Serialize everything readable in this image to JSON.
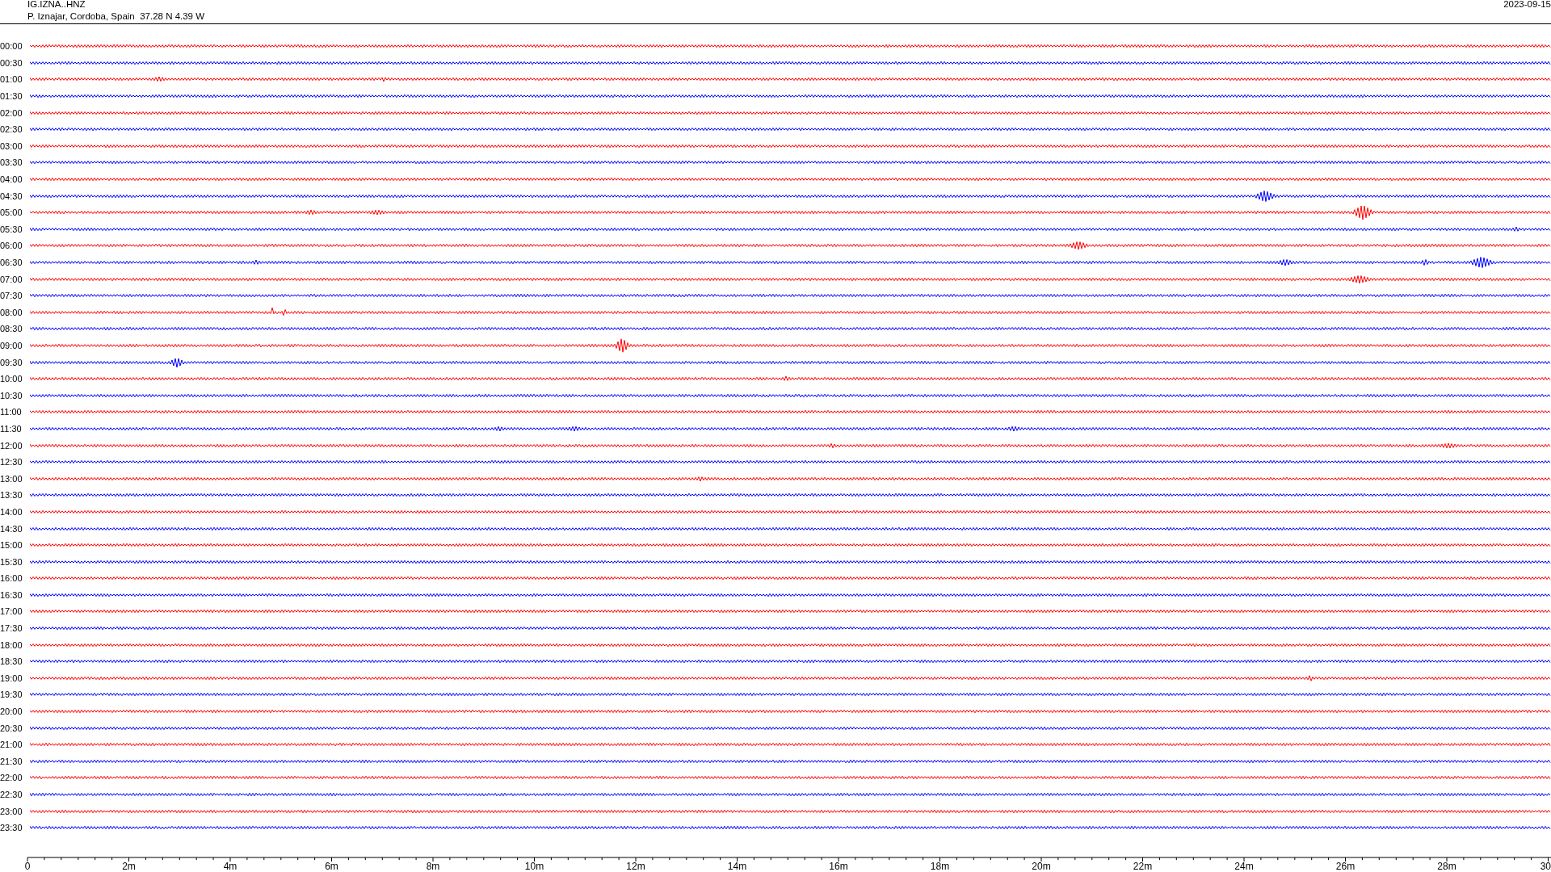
{
  "header": {
    "station": "IG.IZNA..HNZ",
    "location": "P. Iznajar, Cordoba, Spain  37.28 N 4.39 W",
    "date": "2023-09-15"
  },
  "traces": [
    {
      "label": "00:00",
      "color": "#ff0000"
    },
    {
      "label": "00:30",
      "color": "#0000ff"
    },
    {
      "label": "01:00",
      "color": "#ff0000"
    },
    {
      "label": "01:30",
      "color": "#0000ff"
    },
    {
      "label": "02:00",
      "color": "#ff0000"
    },
    {
      "label": "02:30",
      "color": "#0000ff"
    },
    {
      "label": "03:00",
      "color": "#ff0000"
    },
    {
      "label": "03:30",
      "color": "#0000ff"
    },
    {
      "label": "04:00",
      "color": "#ff0000"
    },
    {
      "label": "04:30",
      "color": "#0000ff"
    },
    {
      "label": "05:00",
      "color": "#ff0000"
    },
    {
      "label": "05:30",
      "color": "#0000ff"
    },
    {
      "label": "06:00",
      "color": "#ff0000"
    },
    {
      "label": "06:30",
      "color": "#0000ff"
    },
    {
      "label": "07:00",
      "color": "#ff0000"
    },
    {
      "label": "07:30",
      "color": "#0000ff"
    },
    {
      "label": "08:00",
      "color": "#ff0000"
    },
    {
      "label": "08:30",
      "color": "#0000ff"
    },
    {
      "label": "09:00",
      "color": "#ff0000"
    },
    {
      "label": "09:30",
      "color": "#0000ff"
    },
    {
      "label": "10:00",
      "color": "#ff0000"
    },
    {
      "label": "10:30",
      "color": "#0000ff"
    },
    {
      "label": "11:00",
      "color": "#ff0000"
    },
    {
      "label": "11:30",
      "color": "#0000ff"
    },
    {
      "label": "12:00",
      "color": "#ff0000"
    },
    {
      "label": "12:30",
      "color": "#0000ff"
    },
    {
      "label": "13:00",
      "color": "#ff0000"
    },
    {
      "label": "13:30",
      "color": "#0000ff"
    },
    {
      "label": "14:00",
      "color": "#ff0000"
    },
    {
      "label": "14:30",
      "color": "#0000ff"
    },
    {
      "label": "15:00",
      "color": "#ff0000"
    },
    {
      "label": "15:30",
      "color": "#0000ff"
    },
    {
      "label": "16:00",
      "color": "#ff0000"
    },
    {
      "label": "16:30",
      "color": "#0000ff"
    },
    {
      "label": "17:00",
      "color": "#ff0000"
    },
    {
      "label": "17:30",
      "color": "#0000ff"
    },
    {
      "label": "18:00",
      "color": "#ff0000"
    },
    {
      "label": "18:30",
      "color": "#0000ff"
    },
    {
      "label": "19:00",
      "color": "#ff0000"
    },
    {
      "label": "19:30",
      "color": "#0000ff"
    },
    {
      "label": "20:00",
      "color": "#ff0000"
    },
    {
      "label": "20:30",
      "color": "#0000ff"
    },
    {
      "label": "21:00",
      "color": "#ff0000"
    },
    {
      "label": "21:30",
      "color": "#0000ff"
    },
    {
      "label": "22:00",
      "color": "#ff0000"
    },
    {
      "label": "22:30",
      "color": "#0000ff"
    },
    {
      "label": "23:00",
      "color": "#ff0000"
    },
    {
      "label": "23:30",
      "color": "#0000ff"
    }
  ],
  "time_axis": {
    "labels": [
      "0",
      "2m",
      "4m",
      "6m",
      "8m",
      "10m",
      "12m",
      "14m",
      "16m",
      "18m",
      "20m",
      "22m",
      "24m",
      "26m",
      "28m",
      "30"
    ]
  }
}
